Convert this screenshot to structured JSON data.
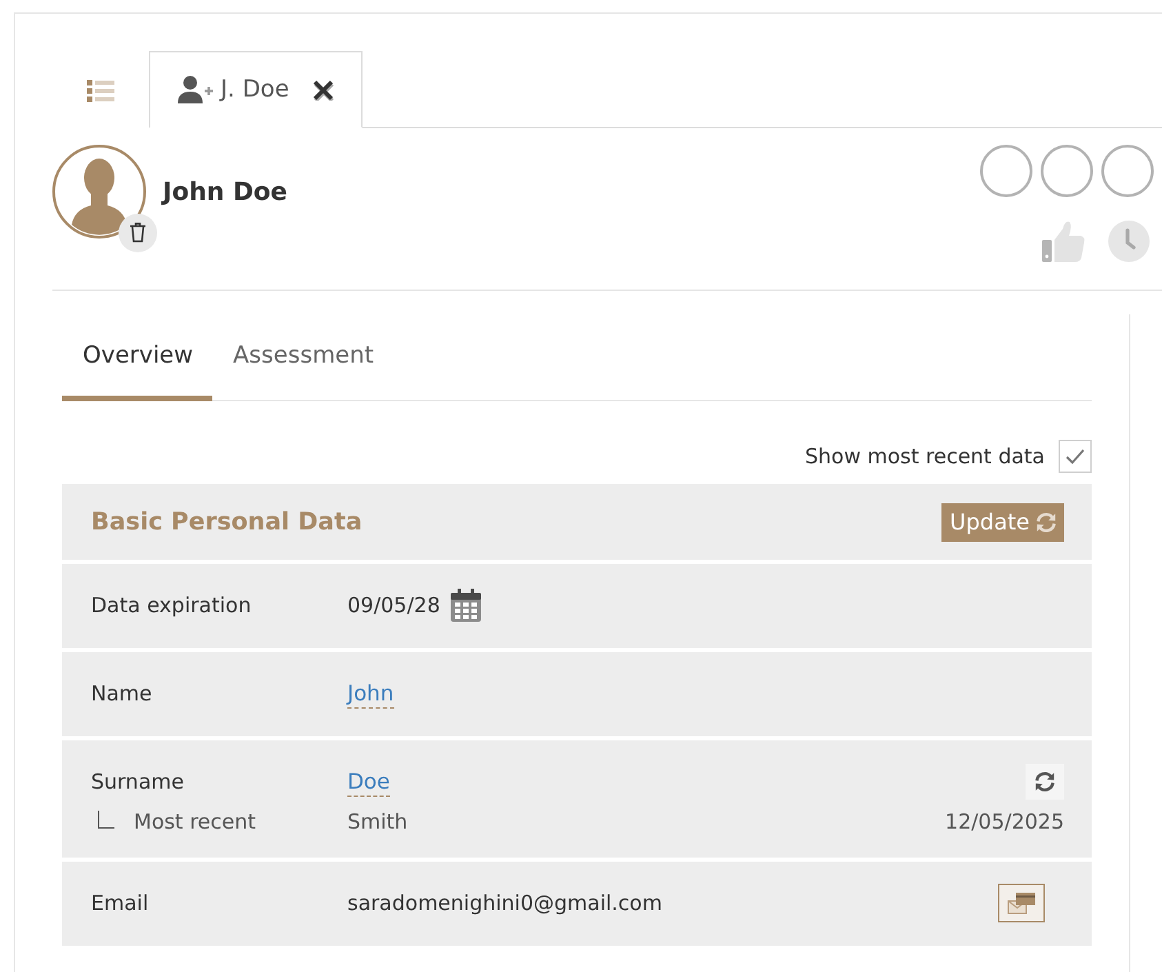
{
  "top_tabs": [
    {
      "kind": "list",
      "selected": false,
      "closable": false
    },
    {
      "kind": "person",
      "label": "J. Doe",
      "selected": true,
      "closable": true
    }
  ],
  "profile": {
    "name": "John Doe"
  },
  "section_tabs": [
    {
      "label": "Overview",
      "selected": true
    },
    {
      "label": "Assessment",
      "selected": false
    }
  ],
  "recent_toggle": {
    "label": "Show most recent data",
    "checked": true
  },
  "section": {
    "title": "Basic Personal Data",
    "update_button": "Update",
    "rows": [
      {
        "kind": "date",
        "label": "Data expiration",
        "value": "09/05/28"
      },
      {
        "kind": "link",
        "label": "Name",
        "value": "John"
      },
      {
        "kind": "link",
        "label": "Surname",
        "value": "Doe",
        "recent": {
          "label": "Most recent",
          "value": "Smith",
          "date": "12/05/2025"
        }
      },
      {
        "kind": "email",
        "label": "Email",
        "value": "saradomenighini0@gmail.com"
      }
    ]
  }
}
